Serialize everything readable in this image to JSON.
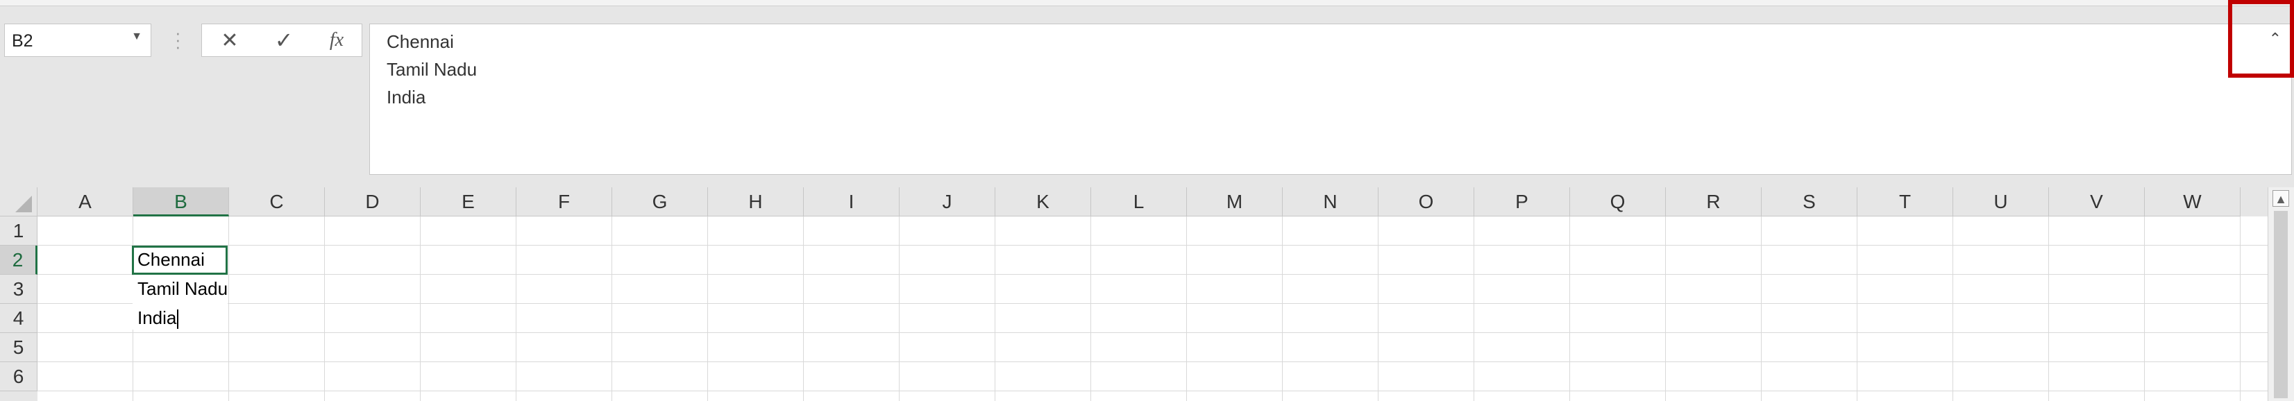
{
  "formula_bar": {
    "name_box": "B2",
    "cancel_glyph": "✕",
    "enter_glyph": "✓",
    "fx_glyph": "fx",
    "content_lines": [
      "Chennai",
      "Tamil Nadu",
      "India"
    ],
    "collapse_glyph": "⌃"
  },
  "grid": {
    "columns": [
      "A",
      "B",
      "C",
      "D",
      "E",
      "F",
      "G",
      "H",
      "I",
      "J",
      "K",
      "L",
      "M",
      "N",
      "O",
      "P",
      "Q",
      "R",
      "S",
      "T",
      "U",
      "V",
      "W"
    ],
    "rows": [
      "1",
      "2",
      "3",
      "4",
      "5",
      "6"
    ],
    "active_column": "B",
    "active_row": "2",
    "cells": {
      "B2": "Chennai",
      "B3": "Tamil Nadu",
      "B4": "India"
    }
  },
  "colors": {
    "accent": "#217346",
    "highlight": "#c00000"
  }
}
